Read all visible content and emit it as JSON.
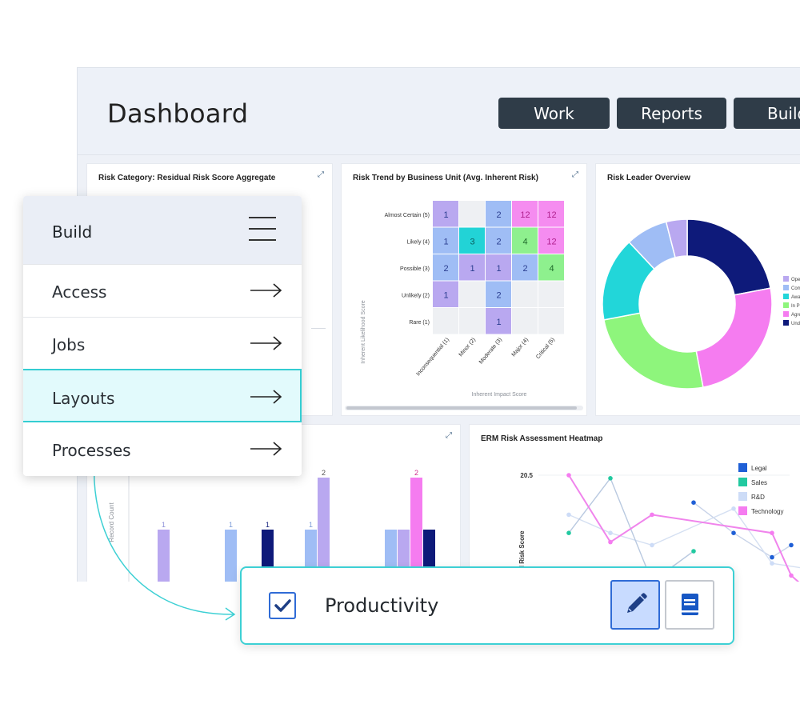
{
  "dashboard": {
    "title": "Dashboard",
    "buttons": [
      "Work",
      "Reports",
      "Build"
    ]
  },
  "cards": {
    "residual": {
      "title": "Risk Category: Residual Risk Score Aggregate"
    },
    "trend": {
      "title": "Risk Trend by Business Unit (Avg. Inherent Risk)",
      "ylabel": "Inherent Likelihood Score",
      "xlabel": "Inherent Impact Score"
    },
    "leader": {
      "title": "Risk Leader Overview"
    },
    "bars": {
      "ylabel": "Record Count"
    },
    "erm": {
      "title": "ERM Risk Assessment Heatmap",
      "ylabel": "ual Risk Score"
    }
  },
  "chart_data": [
    {
      "type": "heatmap",
      "title": "Risk Trend by Business Unit (Avg. Inherent Risk)",
      "xlabel": "Inherent Impact Score",
      "ylabel": "Inherent Likelihood Score",
      "rows": [
        "Almost Certain (5)",
        "Likely (4)",
        "Possible (3)",
        "Unlikely (2)",
        "Rare (1)"
      ],
      "columns": [
        "Inconsequential (1)",
        "Minor (2)",
        "Moderate (3)",
        "Major (4)",
        "Critical (5)"
      ],
      "values": [
        [
          1,
          null,
          2,
          12,
          12
        ],
        [
          1,
          3,
          2,
          4,
          12
        ],
        [
          2,
          1,
          1,
          2,
          4
        ],
        [
          1,
          null,
          2,
          null,
          null
        ],
        [
          null,
          null,
          1,
          null,
          null
        ]
      ],
      "colors": [
        [
          "#b9a8f0",
          null,
          "#9fbdf5",
          "#f58cf0",
          "#f58cf0"
        ],
        [
          "#9fbdf5",
          "#22d3d6",
          "#9fbdf5",
          "#8ef08e",
          "#f58cf0"
        ],
        [
          "#9fbdf5",
          "#b9a8f0",
          "#b9a8f0",
          "#9fbdf5",
          "#8ef08e"
        ],
        [
          "#b9a8f0",
          null,
          "#9fbdf5",
          null,
          null
        ],
        [
          null,
          null,
          "#b9a8f0",
          null,
          null
        ]
      ]
    },
    {
      "type": "pie",
      "title": "Risk Leader Overview",
      "donut": true,
      "slices": [
        {
          "label": "Und",
          "value": 22,
          "color": "#0e1a7a"
        },
        {
          "label": "Agre",
          "value": 25,
          "color": "#f57cf0"
        },
        {
          "label": "In Pr",
          "value": 25,
          "color": "#8ef57c"
        },
        {
          "label": "Awa",
          "value": 16,
          "color": "#22d6d9"
        },
        {
          "label": "Com",
          "value": 8,
          "color": "#9fbdf5"
        },
        {
          "label": "Oper",
          "value": 4,
          "color": "#b9a8f0"
        }
      ],
      "legend": [
        "Oper",
        "Com",
        "Awa",
        "In Pr",
        "Agre",
        "Und"
      ]
    },
    {
      "type": "bar",
      "ylabel": "Record Count",
      "bars": [
        {
          "group": 0,
          "value": 1,
          "label": "1",
          "color": "#b9a8f0",
          "label_color": "#8a8fd8"
        },
        {
          "group": 1,
          "value": 1,
          "label": "1",
          "color": "#9fbdf5",
          "label_color": "#7a9bd8"
        },
        {
          "group": 1,
          "value": 1,
          "label": "1",
          "color": "#0e1a7a",
          "label_color": "#0e1a7a"
        },
        {
          "group": 2,
          "value": 1,
          "label": "1",
          "color": "#9fbdf5",
          "label_color": "#7a9bd8"
        },
        {
          "group": 2,
          "value": 2,
          "label": "2",
          "color": "#b9a8f0",
          "label_color": "#555555"
        },
        {
          "group": 3,
          "value": 1,
          "label": "",
          "color": "#9fbdf5",
          "label_color": "#555555"
        },
        {
          "group": 3,
          "value": 1,
          "label": "",
          "color": "#b9a8f0",
          "label_color": "#555555"
        },
        {
          "group": 3,
          "value": 2,
          "label": "2",
          "color": "#f57cf0",
          "label_color": "#d0308f"
        },
        {
          "group": 3,
          "value": 1,
          "label": "",
          "color": "#0e1a7a",
          "label_color": "#555555"
        }
      ]
    },
    {
      "type": "line",
      "title": "ERM Risk Assessment Heatmap",
      "ylabel": "ual Risk Score",
      "y_tick": "20.5",
      "legend": [
        {
          "name": "Legal",
          "color": "#1f5fd6"
        },
        {
          "name": "Sales",
          "color": "#22c9a0"
        },
        {
          "name": "R&D",
          "color": "#cddcf7"
        },
        {
          "name": "Technology",
          "color": "#f57cf0"
        }
      ],
      "series": [
        {
          "name": "Technology",
          "color": "#f084ec",
          "points": [
            [
              0,
              20.5
            ],
            [
              1,
              9.5
            ],
            [
              2,
              14
            ],
            [
              5,
              11
            ],
            [
              6,
              4
            ],
            [
              7,
              1
            ]
          ]
        },
        {
          "name": "Sales",
          "color": "#b9c9e0",
          "points": [
            [
              0,
              11
            ],
            [
              1,
              20
            ],
            [
              2,
              3
            ],
            [
              3,
              8
            ]
          ]
        },
        {
          "name": "R&D",
          "color": "#d5e0f2",
          "points": [
            [
              0,
              14
            ],
            [
              1,
              11
            ],
            [
              2,
              9
            ],
            [
              4,
              15
            ],
            [
              5,
              6
            ],
            [
              7,
              5
            ]
          ]
        },
        {
          "name": "Legal",
          "color": "#c8d3e8",
          "points": [
            [
              3,
              16
            ],
            [
              4,
              11
            ],
            [
              5,
              7
            ],
            [
              6,
              9
            ]
          ]
        }
      ]
    }
  ],
  "menu": {
    "title": "Build",
    "items": [
      "Access",
      "Jobs",
      "Layouts",
      "Processes"
    ],
    "active_index": 2
  },
  "productivity": {
    "label": "Productivity",
    "checked": true
  }
}
